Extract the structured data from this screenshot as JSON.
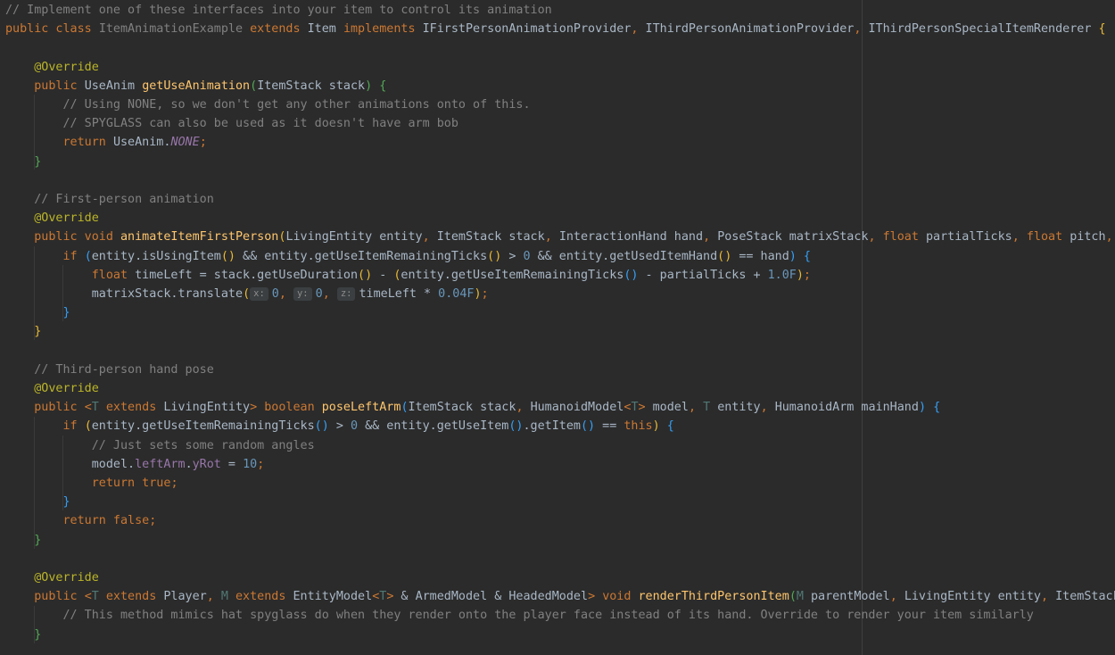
{
  "editor": {
    "language": "java",
    "lines": [
      [
        {
          "t": "// Implement one of these interfaces into your item to control its animation",
          "c": "cm"
        }
      ],
      [
        {
          "t": "public class ",
          "c": "kw"
        },
        {
          "t": "ItemAnimationExample ",
          "c": "cm"
        },
        {
          "t": "extends ",
          "c": "kw"
        },
        {
          "t": "Item ",
          "c": "cls"
        },
        {
          "t": "implements ",
          "c": "kw"
        },
        {
          "t": "IFirstPersonAnimationProvider",
          "c": "cls"
        },
        {
          "t": ", ",
          "c": "pu"
        },
        {
          "t": "IThirdPersonAnimationProvider",
          "c": "cls"
        },
        {
          "t": ", ",
          "c": "pu"
        },
        {
          "t": "IThirdPersonSpecialItemRenderer ",
          "c": "cls"
        },
        {
          "t": "{",
          "c": "b1"
        }
      ],
      [],
      [
        {
          "t": "    "
        },
        {
          "t": "@Override",
          "c": "an"
        }
      ],
      [
        {
          "t": "    "
        },
        {
          "t": "public ",
          "c": "kw"
        },
        {
          "t": "UseAnim ",
          "c": "cls"
        },
        {
          "t": "getUseAnimation",
          "c": "fn"
        },
        {
          "t": "(",
          "c": "b2"
        },
        {
          "t": "ItemStack stack",
          "c": "id"
        },
        {
          "t": ") ",
          "c": "b2"
        },
        {
          "t": "{",
          "c": "b2"
        }
      ],
      [
        {
          "t": "        "
        },
        {
          "t": "// Using NONE, so we don't get any other animations onto of this.",
          "c": "cm"
        }
      ],
      [
        {
          "t": "        "
        },
        {
          "t": "// SPYGLASS can also be used as it doesn't have arm bob",
          "c": "cm"
        }
      ],
      [
        {
          "t": "        "
        },
        {
          "t": "return ",
          "c": "kw"
        },
        {
          "t": "UseAnim.",
          "c": "cls"
        },
        {
          "t": "NONE",
          "c": "st"
        },
        {
          "t": ";",
          "c": "pu"
        }
      ],
      [
        {
          "t": "    "
        },
        {
          "t": "}",
          "c": "b2"
        }
      ],
      [],
      [
        {
          "t": "    "
        },
        {
          "t": "// First-person animation",
          "c": "cm"
        }
      ],
      [
        {
          "t": "    "
        },
        {
          "t": "@Override",
          "c": "an"
        }
      ],
      [
        {
          "t": "    "
        },
        {
          "t": "public void ",
          "c": "kw"
        },
        {
          "t": "animateItemFirstPerson",
          "c": "fn"
        },
        {
          "t": "(",
          "c": "b1"
        },
        {
          "t": "LivingEntity entity",
          "c": "id"
        },
        {
          "t": ", ",
          "c": "pu"
        },
        {
          "t": "ItemStack stack",
          "c": "id"
        },
        {
          "t": ", ",
          "c": "pu"
        },
        {
          "t": "InteractionHand hand",
          "c": "id"
        },
        {
          "t": ", ",
          "c": "pu"
        },
        {
          "t": "PoseStack matrixStack",
          "c": "id"
        },
        {
          "t": ", ",
          "c": "pu"
        },
        {
          "t": "float ",
          "c": "kw"
        },
        {
          "t": "partialTicks",
          "c": "id"
        },
        {
          "t": ", ",
          "c": "pu"
        },
        {
          "t": "float ",
          "c": "kw"
        },
        {
          "t": "pitch",
          "c": "id"
        },
        {
          "t": ", ",
          "c": "pu"
        },
        {
          "t": "f",
          "c": "kw"
        }
      ],
      [
        {
          "t": "        "
        },
        {
          "t": "if ",
          "c": "kw"
        },
        {
          "t": "(",
          "c": "b3"
        },
        {
          "t": "entity.isUsingItem",
          "c": "id"
        },
        {
          "t": "()",
          "c": "b1"
        },
        {
          "t": " && ",
          "c": "op"
        },
        {
          "t": "entity.getUseItemRemainingTicks",
          "c": "id"
        },
        {
          "t": "()",
          "c": "b1"
        },
        {
          "t": " > ",
          "c": "op"
        },
        {
          "t": "0",
          "c": "nu"
        },
        {
          "t": " && ",
          "c": "op"
        },
        {
          "t": "entity.getUsedItemHand",
          "c": "id"
        },
        {
          "t": "()",
          "c": "b1"
        },
        {
          "t": " == ",
          "c": "op"
        },
        {
          "t": "hand",
          "c": "id"
        },
        {
          "t": ") ",
          "c": "b3"
        },
        {
          "t": "{",
          "c": "b3"
        }
      ],
      [
        {
          "t": "            "
        },
        {
          "t": "float ",
          "c": "kw"
        },
        {
          "t": "timeLeft = stack.getUseDuration",
          "c": "id"
        },
        {
          "t": "()",
          "c": "b1"
        },
        {
          "t": " - ",
          "c": "op"
        },
        {
          "t": "(",
          "c": "b1"
        },
        {
          "t": "entity.getUseItemRemainingTicks",
          "c": "id"
        },
        {
          "t": "()",
          "c": "b3"
        },
        {
          "t": " - partialTicks + ",
          "c": "op"
        },
        {
          "t": "1.0F",
          "c": "nu"
        },
        {
          "t": ")",
          "c": "b1"
        },
        {
          "t": ";",
          "c": "pu"
        }
      ],
      [
        {
          "t": "            "
        },
        {
          "t": "matrixStack.translate",
          "c": "id"
        },
        {
          "t": "(",
          "c": "b1"
        },
        {
          "hint": "x:"
        },
        {
          "t": "0",
          "c": "nu"
        },
        {
          "t": ", ",
          "c": "pu"
        },
        {
          "hint": "y:"
        },
        {
          "t": "0",
          "c": "nu"
        },
        {
          "t": ", ",
          "c": "pu"
        },
        {
          "hint": "z:"
        },
        {
          "t": "timeLeft * ",
          "c": "id"
        },
        {
          "t": "0.04F",
          "c": "nu"
        },
        {
          "t": ")",
          "c": "b1"
        },
        {
          "t": ";",
          "c": "pu"
        }
      ],
      [
        {
          "t": "        "
        },
        {
          "t": "}",
          "c": "b3"
        }
      ],
      [
        {
          "t": "    "
        },
        {
          "t": "}",
          "c": "b1"
        }
      ],
      [],
      [
        {
          "t": "    "
        },
        {
          "t": "// Third-person hand pose",
          "c": "cm"
        }
      ],
      [
        {
          "t": "    "
        },
        {
          "t": "@Override",
          "c": "an"
        }
      ],
      [
        {
          "t": "    "
        },
        {
          "t": "public ",
          "c": "kw"
        },
        {
          "t": "<",
          "c": "pu"
        },
        {
          "t": "T ",
          "c": "tp"
        },
        {
          "t": "extends ",
          "c": "kw"
        },
        {
          "t": "LivingEntity",
          "c": "cls"
        },
        {
          "t": "> ",
          "c": "pu"
        },
        {
          "t": "boolean ",
          "c": "kw"
        },
        {
          "t": "poseLeftArm",
          "c": "fn"
        },
        {
          "t": "(",
          "c": "b3"
        },
        {
          "t": "ItemStack stack",
          "c": "id"
        },
        {
          "t": ", ",
          "c": "pu"
        },
        {
          "t": "HumanoidModel",
          "c": "cls"
        },
        {
          "t": "<",
          "c": "pu"
        },
        {
          "t": "T",
          "c": "tp"
        },
        {
          "t": "> ",
          "c": "pu"
        },
        {
          "t": "model",
          "c": "id"
        },
        {
          "t": ", ",
          "c": "pu"
        },
        {
          "t": "T ",
          "c": "tp"
        },
        {
          "t": "entity",
          "c": "id"
        },
        {
          "t": ", ",
          "c": "pu"
        },
        {
          "t": "HumanoidArm mainHand",
          "c": "id"
        },
        {
          "t": ") ",
          "c": "b3"
        },
        {
          "t": "{",
          "c": "b3"
        }
      ],
      [
        {
          "t": "        "
        },
        {
          "t": "if ",
          "c": "kw"
        },
        {
          "t": "(",
          "c": "b1"
        },
        {
          "t": "entity.getUseItemRemainingTicks",
          "c": "id"
        },
        {
          "t": "()",
          "c": "b3"
        },
        {
          "t": " > ",
          "c": "op"
        },
        {
          "t": "0",
          "c": "nu"
        },
        {
          "t": " && ",
          "c": "op"
        },
        {
          "t": "entity.getUseItem",
          "c": "id"
        },
        {
          "t": "()",
          "c": "b3"
        },
        {
          "t": ".getItem",
          "c": "id"
        },
        {
          "t": "()",
          "c": "b3"
        },
        {
          "t": " == ",
          "c": "op"
        },
        {
          "t": "this",
          "c": "kw"
        },
        {
          "t": ") ",
          "c": "b1"
        },
        {
          "t": "{",
          "c": "b3"
        }
      ],
      [
        {
          "t": "            "
        },
        {
          "t": "// Just sets some random angles",
          "c": "cm"
        }
      ],
      [
        {
          "t": "            "
        },
        {
          "t": "model.",
          "c": "id"
        },
        {
          "t": "leftArm",
          "c": "fd"
        },
        {
          "t": ".",
          "c": "id"
        },
        {
          "t": "yRot",
          "c": "fd"
        },
        {
          "t": " = ",
          "c": "op"
        },
        {
          "t": "10",
          "c": "nu"
        },
        {
          "t": ";",
          "c": "pu"
        }
      ],
      [
        {
          "t": "            "
        },
        {
          "t": "return true",
          "c": "kw"
        },
        {
          "t": ";",
          "c": "pu"
        }
      ],
      [
        {
          "t": "        "
        },
        {
          "t": "}",
          "c": "b3"
        }
      ],
      [
        {
          "t": "        "
        },
        {
          "t": "return false",
          "c": "kw"
        },
        {
          "t": ";",
          "c": "pu"
        }
      ],
      [
        {
          "t": "    "
        },
        {
          "t": "}",
          "c": "b2"
        }
      ],
      [],
      [
        {
          "t": "    "
        },
        {
          "t": "@Override",
          "c": "an"
        }
      ],
      [
        {
          "t": "    "
        },
        {
          "t": "public ",
          "c": "kw"
        },
        {
          "t": "<",
          "c": "pu"
        },
        {
          "t": "T ",
          "c": "tp"
        },
        {
          "t": "extends ",
          "c": "kw"
        },
        {
          "t": "Player",
          "c": "cls"
        },
        {
          "t": ", ",
          "c": "pu"
        },
        {
          "t": "M ",
          "c": "tp"
        },
        {
          "t": "extends ",
          "c": "kw"
        },
        {
          "t": "EntityModel",
          "c": "cls"
        },
        {
          "t": "<",
          "c": "pu"
        },
        {
          "t": "T",
          "c": "tp"
        },
        {
          "t": ">",
          "c": "pu"
        },
        {
          "t": " & ",
          "c": "op"
        },
        {
          "t": "ArmedModel",
          "c": "cls"
        },
        {
          "t": " & ",
          "c": "op"
        },
        {
          "t": "HeadedModel",
          "c": "cls"
        },
        {
          "t": "> ",
          "c": "pu"
        },
        {
          "t": "void ",
          "c": "kw"
        },
        {
          "t": "renderThirdPersonItem",
          "c": "fn"
        },
        {
          "t": "(",
          "c": "b2"
        },
        {
          "t": "M ",
          "c": "tp"
        },
        {
          "t": "parentModel",
          "c": "id"
        },
        {
          "t": ", ",
          "c": "pu"
        },
        {
          "t": "LivingEntity entity",
          "c": "id"
        },
        {
          "t": ", ",
          "c": "pu"
        },
        {
          "t": "ItemStack",
          "c": "cls"
        }
      ],
      [
        {
          "t": "        "
        },
        {
          "t": "// This method mimics hat spyglass do when they render onto the player face instead of its hand. Override to render your item similarly",
          "c": "cm"
        }
      ],
      [
        {
          "t": "    "
        },
        {
          "t": "}",
          "c": "b2"
        }
      ]
    ]
  }
}
